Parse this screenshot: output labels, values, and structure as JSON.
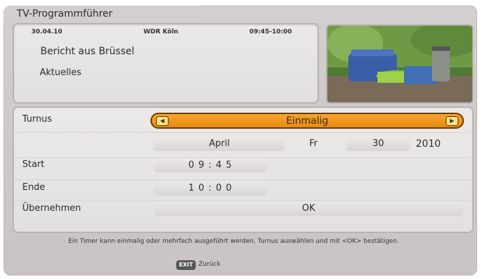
{
  "header": {
    "title": "TV-Programmführer"
  },
  "info": {
    "date": "30.04.10",
    "channel": "WDR Köln",
    "time": "09:45-10:00",
    "program": "Bericht aus Brüssel",
    "genre": "Aktuelles"
  },
  "form": {
    "turnus": {
      "label": "Turnus",
      "value": "Einmalig"
    },
    "date": {
      "month": "April",
      "weekday": "Fr",
      "day": "30",
      "year": "2010"
    },
    "start": {
      "label": "Start",
      "value": "0 9 : 4 5"
    },
    "end": {
      "label": "Ende",
      "value": "1 0 : 0 0"
    },
    "apply": {
      "label": "Übernehmen",
      "button": "OK"
    }
  },
  "help_text": "Ein Timer kann einmalig oder mehrfach ausgeführt werden. Turnus auswählen und mit <OK> bestätigen.",
  "footer": {
    "exit_key": "EXIT",
    "back_label": "Zurück"
  },
  "colors": {
    "accent": "#f0981e",
    "panel": "#d4cfcf"
  },
  "icons": {
    "left": "left-arrow-icon",
    "right": "right-arrow-icon"
  }
}
